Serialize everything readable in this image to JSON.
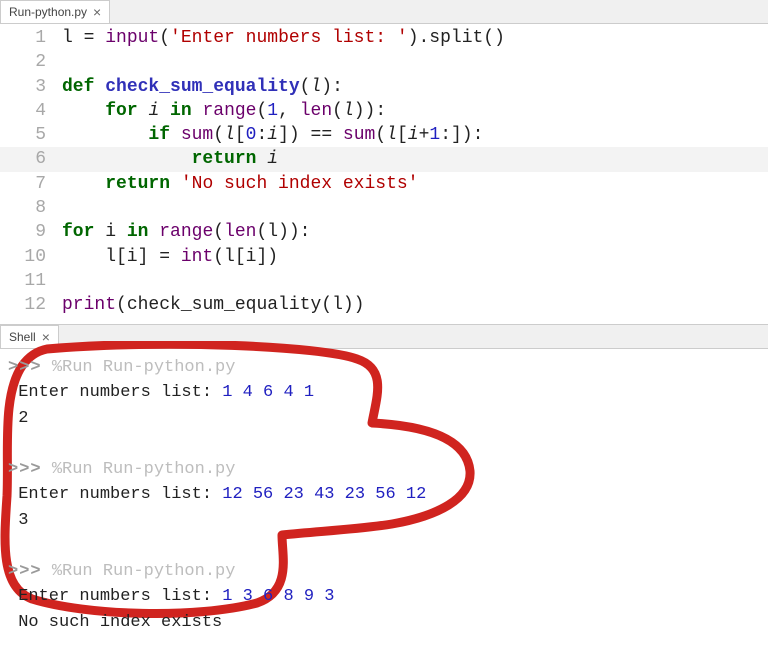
{
  "editor_tab": {
    "filename": "Run-python.py",
    "close_glyph": "×"
  },
  "code": {
    "lines": [
      {
        "n": "1",
        "hl": false
      },
      {
        "n": "2",
        "hl": false
      },
      {
        "n": "3",
        "hl": false
      },
      {
        "n": "4",
        "hl": false
      },
      {
        "n": "5",
        "hl": false
      },
      {
        "n": "6",
        "hl": true
      },
      {
        "n": "7",
        "hl": false
      },
      {
        "n": "8",
        "hl": false
      },
      {
        "n": "9",
        "hl": false
      },
      {
        "n": "10",
        "hl": false
      },
      {
        "n": "11",
        "hl": false
      },
      {
        "n": "12",
        "hl": false
      }
    ],
    "tokens": {
      "l1_input": "input",
      "l1_prompt": "'Enter numbers list: '",
      "l1_split": ".split()",
      "l1_assign": "l = ",
      "l3_def": "def ",
      "l3_name": "check_sum_equality",
      "l3_param": "l",
      "l4_for": "for ",
      "l4_i": "i",
      "l4_in": " in ",
      "l4_range": "range",
      "l4_args_open": "(",
      "l4_one": "1",
      "l4_comma": ", ",
      "l4_len": "len",
      "l4_l": "l",
      "l5_if": "if ",
      "l5_sum": "sum",
      "l5_slice1_open": "(",
      "l5_slice1": "l",
      "l5_slice1_a": "[",
      "l5_zero": "0",
      "l5_colon": ":",
      "l5_i1": "i",
      "l5_slice1_b": "]) == ",
      "l5_slice2": "l",
      "l5_slice2_a": "[",
      "l5_i2": "i",
      "l5_plus1": "+",
      "l5_one2": "1",
      "l5_slice2_b": ":]):",
      "l6_return": "return ",
      "l6_i": "i",
      "l7_return": "return ",
      "l7_str": "'No such index exists'",
      "l9_for": "for ",
      "l9_in": "in ",
      "l9_range": "range",
      "l9_len": "len",
      "l10_int": "int",
      "l12_print": "print",
      "l12_fn": "check_sum_equality"
    }
  },
  "shell_tab": {
    "label": "Shell",
    "close_glyph": "×"
  },
  "shell": {
    "prompt": ">>>",
    "run_cmd": "%Run Run-python.py",
    "input_label": "Enter numbers list: ",
    "sessions": [
      {
        "input": "1 4 6 4 1",
        "output": "2"
      },
      {
        "input": "12 56 23 43 23 56 12",
        "output": "3"
      },
      {
        "input": "1 3 6 8 9 3",
        "output": "No such index exists"
      }
    ]
  }
}
